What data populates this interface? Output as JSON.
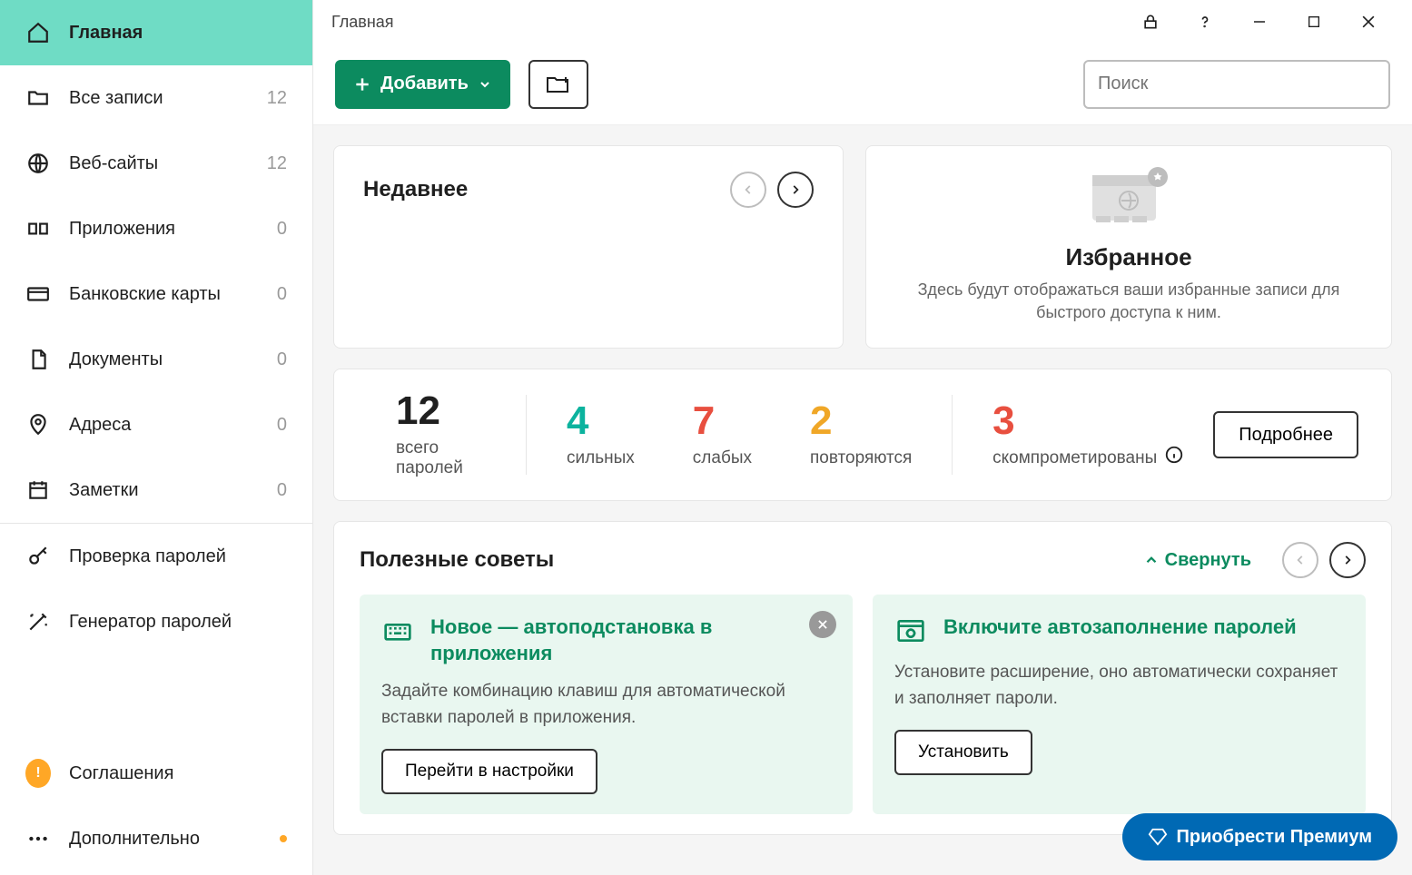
{
  "titlebar": {
    "title": "Главная"
  },
  "sidebar": {
    "items": [
      {
        "label": "Главная",
        "count": null
      },
      {
        "label": "Все записи",
        "count": "12"
      },
      {
        "label": "Веб-сайты",
        "count": "12"
      },
      {
        "label": "Приложения",
        "count": "0"
      },
      {
        "label": "Банковские карты",
        "count": "0"
      },
      {
        "label": "Документы",
        "count": "0"
      },
      {
        "label": "Адреса",
        "count": "0"
      },
      {
        "label": "Заметки",
        "count": "0"
      }
    ],
    "tools": [
      {
        "label": "Проверка паролей"
      },
      {
        "label": "Генератор паролей"
      }
    ],
    "bottom": [
      {
        "label": "Соглашения"
      },
      {
        "label": "Дополнительно"
      }
    ]
  },
  "toolbar": {
    "add_label": "Добавить",
    "search_placeholder": "Поиск"
  },
  "recent": {
    "title": "Недавнее"
  },
  "favorites": {
    "title": "Избранное",
    "desc": "Здесь будут отображаться ваши избранные записи для быстрого доступа к ним."
  },
  "stats": {
    "total": {
      "num": "12",
      "label": "всего паролей"
    },
    "strong": {
      "num": "4",
      "label": "сильных"
    },
    "weak": {
      "num": "7",
      "label": "слабых"
    },
    "repeat": {
      "num": "2",
      "label": "повторяются"
    },
    "compromised": {
      "num": "3",
      "label": "скомпрометированы"
    },
    "details_label": "Подробнее"
  },
  "tips": {
    "title": "Полезные советы",
    "collapse_label": "Свернуть",
    "items": [
      {
        "title": "Новое — автоподстановка в приложения",
        "desc": "Задайте комбинацию клавиш для автоматической вставки паролей в приложения.",
        "button": "Перейти в настройки"
      },
      {
        "title": "Включите автозаполнение паролей",
        "desc": "Установите расширение, оно автоматически сохраняет и заполняет пароли.",
        "button": "Установить"
      }
    ]
  },
  "premium": {
    "label": "Приобрести Премиум"
  }
}
